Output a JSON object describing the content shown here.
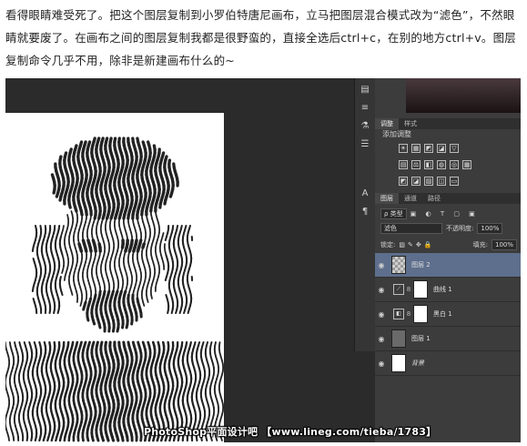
{
  "intro_text": "看得眼睛难受死了。把这个图层复制到小罗伯特唐尼画布，立马把图层混合模式改为“滤色”，不然眼睛就要废了。在画布之间的图层复制我都是很野蛮的，直接全选后ctrl+c，在别的地方ctrl+v。图层复制命令几乎不用，除非是新建画布什么的~",
  "watermark": "PhotoShop平面设计吧 【www.lineg.com/tieba/1783】",
  "tool_strip": {
    "icons": [
      "brush-preset-icon",
      "history-icon",
      "tool-presets-icon",
      "layer-comps-icon",
      "character-icon",
      "paragraph-icon"
    ],
    "glyphs": [
      "▤",
      "≡",
      "⚗",
      "☰",
      "A",
      "¶"
    ]
  },
  "adjust_panel": {
    "tabs": [
      "调整",
      "样式"
    ],
    "title": "添加调整",
    "row1": [
      "☀",
      "▦",
      "◩",
      "◪",
      "▽"
    ],
    "row2": [
      "▤",
      "⚖",
      "◧",
      "◍",
      "◎",
      "▦"
    ],
    "row3": [
      "◩",
      "◪",
      "▨",
      "◫",
      "▭"
    ]
  },
  "layers_panel": {
    "tabs": [
      "图层",
      "通道",
      "路径"
    ],
    "filter_label": "ρ 类型",
    "filter_icons": [
      "▣",
      "◐",
      "T",
      "▢",
      "▣"
    ],
    "blend_mode": "滤色",
    "opacity_label": "不透明度:",
    "opacity_value": "100%",
    "lock_label": "锁定:",
    "lock_icons": [
      "▨",
      "✎",
      "✥",
      "🔒"
    ],
    "fill_label": "填充:",
    "fill_value": "100%",
    "layers": [
      {
        "name": "图层 2",
        "thumb": "checker",
        "selected": true,
        "visible": true,
        "type": "pixel"
      },
      {
        "name": "曲线 1",
        "thumb": "adj",
        "adj_icon": "⟋",
        "selected": false,
        "visible": true,
        "type": "adjustment"
      },
      {
        "name": "黑白 1",
        "thumb": "adj",
        "adj_icon": "◧",
        "selected": false,
        "visible": true,
        "type": "adjustment"
      },
      {
        "name": "图层 1",
        "thumb": "dark",
        "selected": false,
        "visible": true,
        "type": "pixel"
      },
      {
        "name": "背景",
        "thumb": "white",
        "selected": false,
        "visible": true,
        "type": "background"
      }
    ],
    "visibility_glyph": "◉"
  }
}
